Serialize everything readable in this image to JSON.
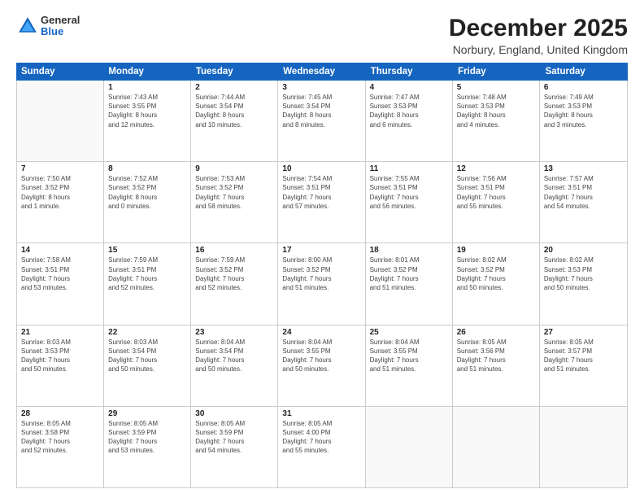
{
  "logo": {
    "general": "General",
    "blue": "Blue"
  },
  "header": {
    "month": "December 2025",
    "location": "Norbury, England, United Kingdom"
  },
  "weekdays": [
    "Sunday",
    "Monday",
    "Tuesday",
    "Wednesday",
    "Thursday",
    "Friday",
    "Saturday"
  ],
  "weeks": [
    [
      {
        "day": "",
        "info": ""
      },
      {
        "day": "1",
        "info": "Sunrise: 7:43 AM\nSunset: 3:55 PM\nDaylight: 8 hours\nand 12 minutes."
      },
      {
        "day": "2",
        "info": "Sunrise: 7:44 AM\nSunset: 3:54 PM\nDaylight: 8 hours\nand 10 minutes."
      },
      {
        "day": "3",
        "info": "Sunrise: 7:45 AM\nSunset: 3:54 PM\nDaylight: 8 hours\nand 8 minutes."
      },
      {
        "day": "4",
        "info": "Sunrise: 7:47 AM\nSunset: 3:53 PM\nDaylight: 8 hours\nand 6 minutes."
      },
      {
        "day": "5",
        "info": "Sunrise: 7:48 AM\nSunset: 3:53 PM\nDaylight: 8 hours\nand 4 minutes."
      },
      {
        "day": "6",
        "info": "Sunrise: 7:49 AM\nSunset: 3:53 PM\nDaylight: 8 hours\nand 3 minutes."
      }
    ],
    [
      {
        "day": "7",
        "info": "Sunrise: 7:50 AM\nSunset: 3:52 PM\nDaylight: 8 hours\nand 1 minute."
      },
      {
        "day": "8",
        "info": "Sunrise: 7:52 AM\nSunset: 3:52 PM\nDaylight: 8 hours\nand 0 minutes."
      },
      {
        "day": "9",
        "info": "Sunrise: 7:53 AM\nSunset: 3:52 PM\nDaylight: 7 hours\nand 58 minutes."
      },
      {
        "day": "10",
        "info": "Sunrise: 7:54 AM\nSunset: 3:51 PM\nDaylight: 7 hours\nand 57 minutes."
      },
      {
        "day": "11",
        "info": "Sunrise: 7:55 AM\nSunset: 3:51 PM\nDaylight: 7 hours\nand 56 minutes."
      },
      {
        "day": "12",
        "info": "Sunrise: 7:56 AM\nSunset: 3:51 PM\nDaylight: 7 hours\nand 55 minutes."
      },
      {
        "day": "13",
        "info": "Sunrise: 7:57 AM\nSunset: 3:51 PM\nDaylight: 7 hours\nand 54 minutes."
      }
    ],
    [
      {
        "day": "14",
        "info": "Sunrise: 7:58 AM\nSunset: 3:51 PM\nDaylight: 7 hours\nand 53 minutes."
      },
      {
        "day": "15",
        "info": "Sunrise: 7:59 AM\nSunset: 3:51 PM\nDaylight: 7 hours\nand 52 minutes."
      },
      {
        "day": "16",
        "info": "Sunrise: 7:59 AM\nSunset: 3:52 PM\nDaylight: 7 hours\nand 52 minutes."
      },
      {
        "day": "17",
        "info": "Sunrise: 8:00 AM\nSunset: 3:52 PM\nDaylight: 7 hours\nand 51 minutes."
      },
      {
        "day": "18",
        "info": "Sunrise: 8:01 AM\nSunset: 3:52 PM\nDaylight: 7 hours\nand 51 minutes."
      },
      {
        "day": "19",
        "info": "Sunrise: 8:02 AM\nSunset: 3:52 PM\nDaylight: 7 hours\nand 50 minutes."
      },
      {
        "day": "20",
        "info": "Sunrise: 8:02 AM\nSunset: 3:53 PM\nDaylight: 7 hours\nand 50 minutes."
      }
    ],
    [
      {
        "day": "21",
        "info": "Sunrise: 8:03 AM\nSunset: 3:53 PM\nDaylight: 7 hours\nand 50 minutes."
      },
      {
        "day": "22",
        "info": "Sunrise: 8:03 AM\nSunset: 3:54 PM\nDaylight: 7 hours\nand 50 minutes."
      },
      {
        "day": "23",
        "info": "Sunrise: 8:04 AM\nSunset: 3:54 PM\nDaylight: 7 hours\nand 50 minutes."
      },
      {
        "day": "24",
        "info": "Sunrise: 8:04 AM\nSunset: 3:55 PM\nDaylight: 7 hours\nand 50 minutes."
      },
      {
        "day": "25",
        "info": "Sunrise: 8:04 AM\nSunset: 3:55 PM\nDaylight: 7 hours\nand 51 minutes."
      },
      {
        "day": "26",
        "info": "Sunrise: 8:05 AM\nSunset: 3:56 PM\nDaylight: 7 hours\nand 51 minutes."
      },
      {
        "day": "27",
        "info": "Sunrise: 8:05 AM\nSunset: 3:57 PM\nDaylight: 7 hours\nand 51 minutes."
      }
    ],
    [
      {
        "day": "28",
        "info": "Sunrise: 8:05 AM\nSunset: 3:58 PM\nDaylight: 7 hours\nand 52 minutes."
      },
      {
        "day": "29",
        "info": "Sunrise: 8:05 AM\nSunset: 3:59 PM\nDaylight: 7 hours\nand 53 minutes."
      },
      {
        "day": "30",
        "info": "Sunrise: 8:05 AM\nSunset: 3:59 PM\nDaylight: 7 hours\nand 54 minutes."
      },
      {
        "day": "31",
        "info": "Sunrise: 8:05 AM\nSunset: 4:00 PM\nDaylight: 7 hours\nand 55 minutes."
      },
      {
        "day": "",
        "info": ""
      },
      {
        "day": "",
        "info": ""
      },
      {
        "day": "",
        "info": ""
      }
    ]
  ]
}
